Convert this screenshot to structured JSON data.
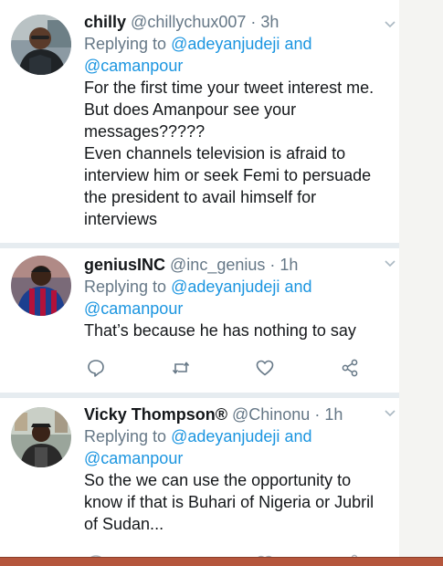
{
  "tweets": [
    {
      "name": "chilly",
      "handle": "@chillychux007",
      "separator": "·",
      "time": "3h",
      "replying_prefix": "Replying to",
      "reply_mention_1": "@adeyanjudeji",
      "reply_and": "and",
      "reply_mention_2": "@camanpour",
      "lines": [
        "For the first time your tweet interest me.",
        "But does Amanpour see your",
        "messages?????",
        "Even channels television is afraid to",
        "interview him or seek Femi to persuade",
        "the president to avail himself for",
        "interviews"
      ]
    },
    {
      "name": "geniusINC",
      "handle": "@inc_genius",
      "separator": "·",
      "time": "1h",
      "replying_prefix": "Replying to",
      "reply_mention_1": "@adeyanjudeji",
      "reply_and": "and",
      "reply_mention_2": "@camanpour",
      "lines": [
        "That’s because he has nothing to say"
      ]
    },
    {
      "name": "Vicky Thompson®",
      "handle": "@Chinonu",
      "separator": "·",
      "time": "1h",
      "replying_prefix": "Replying to",
      "reply_mention_1": "@adeyanjudeji",
      "reply_and": "and",
      "reply_mention_2": "@camanpour",
      "lines": [
        "So the we can use the opportunity to",
        "know if that is Buhari of Nigeria or Jubril",
        "of Sudan..."
      ]
    }
  ],
  "icons": {
    "caret": "chevron-down-icon",
    "reply": "reply-icon",
    "retweet": "retweet-icon",
    "like": "heart-icon",
    "share": "share-icon"
  },
  "colors": {
    "accent": "#1b95e0",
    "secondary_text": "#657786",
    "primary_text": "#14171a",
    "divider": "#e6ecf0",
    "bottom_bar": "#b5563c"
  }
}
